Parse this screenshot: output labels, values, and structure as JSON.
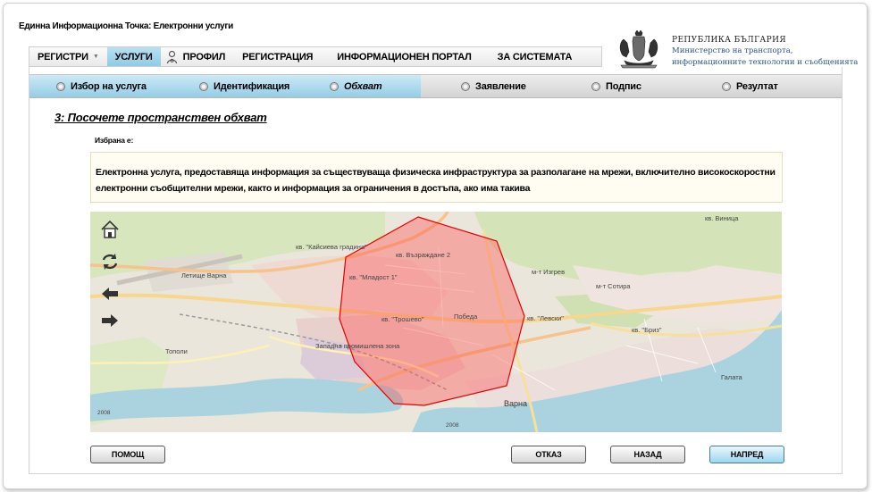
{
  "app_title": "Единна Информационна Точка: Електронни услуги",
  "nav": {
    "items": [
      {
        "label": "РЕГИСТРИ",
        "has_caret": true,
        "active": false
      },
      {
        "label": "УСЛУГИ",
        "active": true
      },
      {
        "label": "ПРОФИЛ",
        "has_icon": true,
        "active": false
      },
      {
        "label": "РЕГИСТРАЦИЯ",
        "active": false
      },
      {
        "label": "ИНФОРМАЦИОНЕН ПОРТАЛ",
        "active": false
      },
      {
        "label": "ЗА СИСТЕМАТА",
        "active": false
      }
    ]
  },
  "ministry": {
    "republic": "РЕПУБЛИКА БЪЛГАРИЯ",
    "line1": "Министерство на транспорта,",
    "line2": "информационните технологии и съобщенията"
  },
  "steps": {
    "items": [
      "Избор на услуга",
      "Идентификация",
      "Обхват",
      "Заявление",
      "Подпис",
      "Резултат"
    ],
    "current_index": 2
  },
  "section_title": "3: Посочете пространствен обхват",
  "selected_label": "Избрана е:",
  "service_text": "Електронна услуга, предоставяща информация за съществуваща физическа инфраструктура за разполагане на мрежи, включително високоскоростни електронни съобщителни мрежи, както и информация за ограничения в достъпа, ако има такива",
  "map": {
    "labels": [
      "кв. Виница",
      "кв. \"Кайсиева градина\"",
      "кв. Възраждане 2",
      "кв. \"Младост 1\"",
      "кв. \"Трошево\"",
      "Победа",
      "кв. \"Левски\"",
      "Западна промишлена зона",
      "Варна",
      "Тополи",
      "Летище Варна",
      "м-т Изгрев",
      "м-т Сотира",
      "кв. \"Бриз\"",
      "Галата",
      "2008",
      "2008"
    ],
    "accent_polygon": "#ff0000",
    "controls": [
      "home-icon",
      "refresh-icon",
      "pan-left-icon",
      "pan-right-icon"
    ]
  },
  "buttons": {
    "help": "ПОМОЩ",
    "cancel": "ОТКАЗ",
    "back": "НАЗАД",
    "next": "НАПРЕД"
  }
}
